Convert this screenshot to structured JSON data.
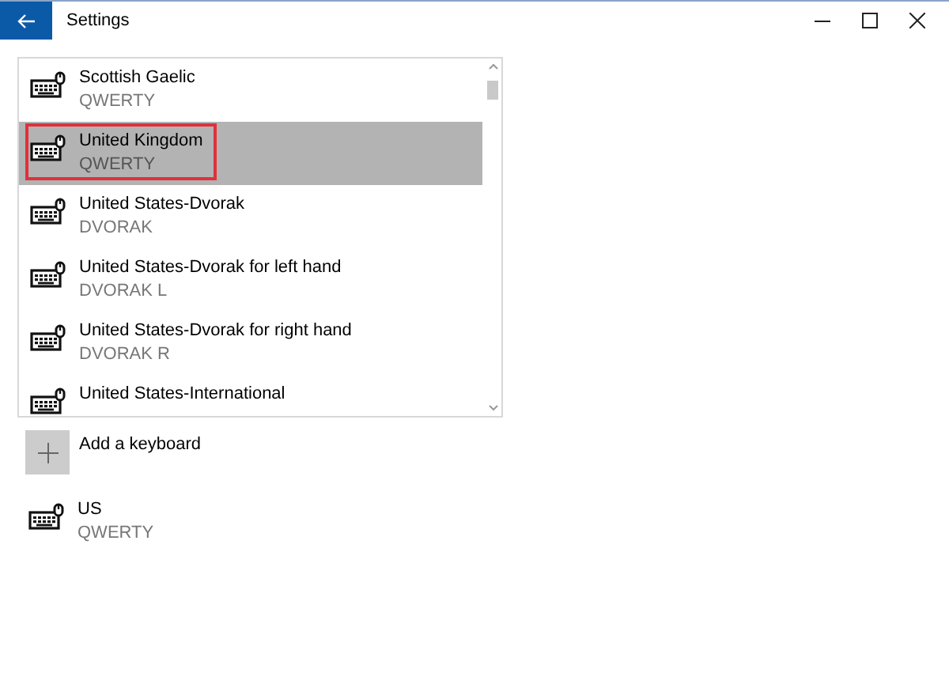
{
  "window": {
    "title": "Settings"
  },
  "layout_list": [
    {
      "name": "Scottish Gaelic",
      "layout": "QWERTY",
      "selected": false,
      "outlined": false
    },
    {
      "name": "United Kingdom",
      "layout": "QWERTY",
      "selected": true,
      "outlined": true
    },
    {
      "name": "United States-Dvorak",
      "layout": "DVORAK",
      "selected": false,
      "outlined": false
    },
    {
      "name": "United States-Dvorak for left hand",
      "layout": "DVORAK L",
      "selected": false,
      "outlined": false
    },
    {
      "name": "United States-Dvorak for right hand",
      "layout": "DVORAK R",
      "selected": false,
      "outlined": false
    },
    {
      "name": "United States-International",
      "selected": false,
      "outlined": false
    }
  ],
  "add_keyboard": {
    "label": "Add a keyboard"
  },
  "installed_keyboards": [
    {
      "name": "US",
      "layout": "QWERTY"
    }
  ]
}
